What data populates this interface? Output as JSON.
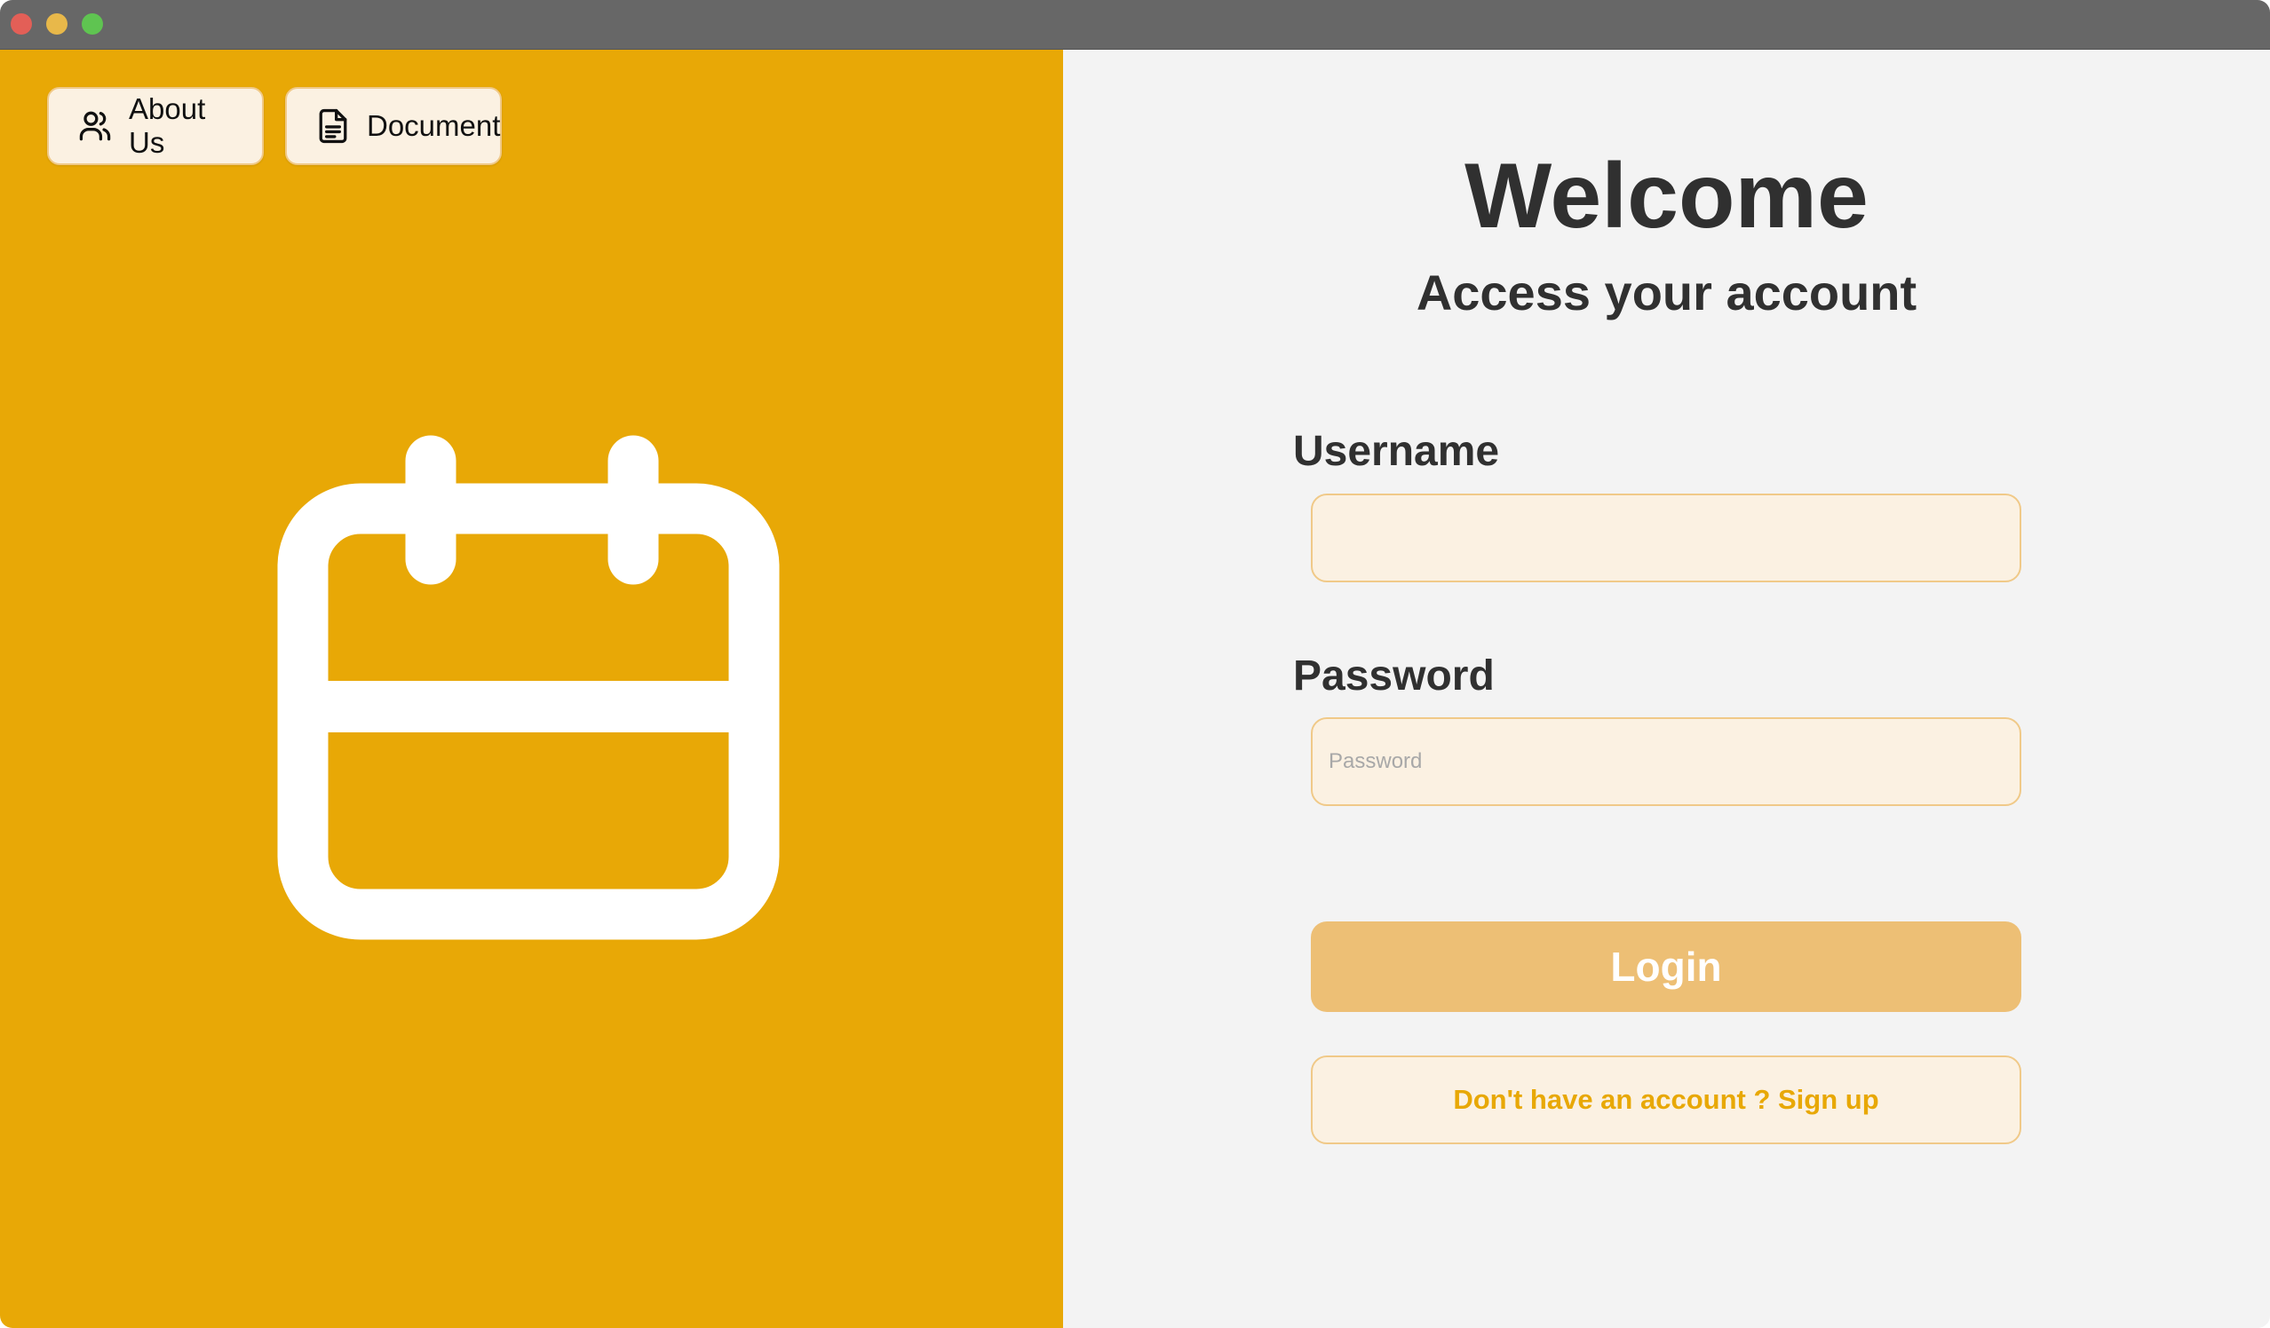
{
  "colors": {
    "titlebar": "#676767",
    "left_panel_bg": "#e8a806",
    "right_panel_bg": "#f3f3f3",
    "close_light": "#e35f57",
    "minimize_light": "#e8b84a",
    "zoom_light": "#5fc451",
    "heading_text": "#303030",
    "button_bg": "#fbf1e2",
    "button_border": "#f0c988",
    "login_bg": "#edbf75",
    "accent_text": "#e8a806",
    "hero_icon": "#ffffff"
  },
  "window": {
    "traffic_lights": [
      "close",
      "minimize",
      "zoom"
    ]
  },
  "left_panel": {
    "buttons": [
      {
        "label": "About Us",
        "icon": "users-icon"
      },
      {
        "label": "Document",
        "icon": "document-icon"
      }
    ],
    "hero_icon": "calendar-icon"
  },
  "login": {
    "title": "Welcome",
    "subtitle": "Access your account",
    "username": {
      "label": "Username",
      "value": "",
      "placeholder": ""
    },
    "password": {
      "label": "Password",
      "value": "",
      "placeholder": "Password"
    },
    "login_button": "Login",
    "signup_button": "Don't have an account ? Sign up"
  }
}
